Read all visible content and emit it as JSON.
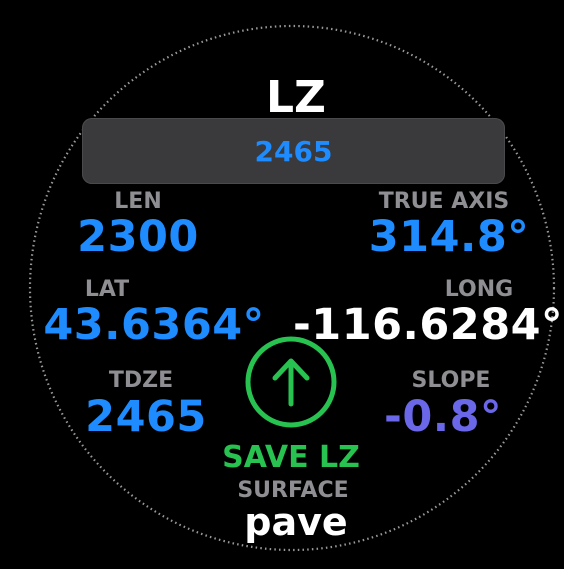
{
  "screen": {
    "title": "LZ",
    "tdze_input_value": "2465"
  },
  "fields": {
    "len": {
      "label": "LEN",
      "value": "2300"
    },
    "true_axis": {
      "label": "TRUE AXIS",
      "value": "314.8°"
    },
    "lat": {
      "label": "LAT",
      "value": "43.6364°"
    },
    "long": {
      "label": "LONG",
      "value": "-116.6284°"
    },
    "tdze": {
      "label": "TDZE",
      "value": "2465"
    },
    "slope": {
      "label": "SLOPE",
      "value": "-0.8°"
    },
    "surface": {
      "label": "SURFACE",
      "value": "pave"
    }
  },
  "save_button": {
    "label": "SAVE LZ",
    "icon": "arrow-up-circle-icon"
  },
  "colors": {
    "accent_blue": "#1e8cff",
    "save_green": "#27c24f",
    "slope_purple": "#6a67e8",
    "label_gray": "#8e8e93",
    "field_bg": "#3a3a3c"
  }
}
